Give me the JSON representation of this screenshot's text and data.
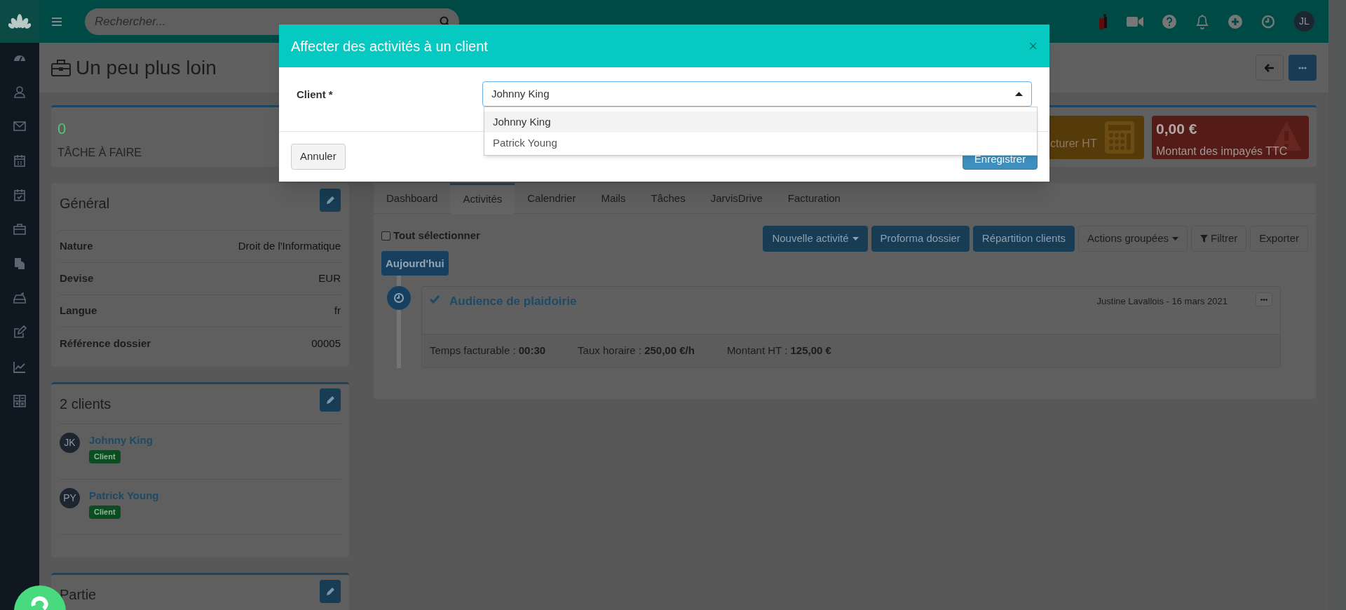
{
  "top_bar": {
    "search": {
      "placeholder": "Rechercher..."
    },
    "avatar": "JL"
  },
  "page": {
    "title": "Un peu plus loin"
  },
  "stats": [
    {
      "kind": "counter",
      "value": "0",
      "label": "TÂCHE À FAIRE"
    },
    {
      "kind": "tile",
      "label": "cturer HT",
      "color": "#553a0a"
    },
    {
      "kind": "tile",
      "value": "0,00 €",
      "label": "Montant des impayés TTC",
      "color": "#541b17"
    }
  ],
  "general": {
    "title": "Général",
    "rows": [
      {
        "label": "Nature",
        "value": "Droit de l'Informatique"
      },
      {
        "label": "Devise",
        "value": "EUR"
      },
      {
        "label": "Langue",
        "value": "fr"
      },
      {
        "label": "Référence dossier",
        "value": "00005"
      }
    ]
  },
  "clients": {
    "title": "2 clients",
    "items": [
      {
        "initials": "JK",
        "name": "Johnny King",
        "tag": "Client"
      },
      {
        "initials": "PY",
        "name": "Patrick Young",
        "tag": "Client"
      }
    ]
  },
  "partie": {
    "title": "Partie"
  },
  "tabs": [
    {
      "label": "Dashboard",
      "selected": false
    },
    {
      "label": "Activités",
      "selected": true
    },
    {
      "label": "Calendrier",
      "selected": false
    },
    {
      "label": "Mails",
      "selected": false
    },
    {
      "label": "Tâches",
      "selected": false
    },
    {
      "label": "JarvisDrive",
      "selected": false
    },
    {
      "label": "Facturation",
      "selected": false
    }
  ],
  "select_all": {
    "label": "Tout sélectionner",
    "checked": false
  },
  "actions": [
    {
      "label": "Nouvelle activité",
      "kind": "primary",
      "caret": true
    },
    {
      "label": "Proforma dossier",
      "kind": "primary",
      "caret": false
    },
    {
      "label": "Répartition clients",
      "kind": "primary",
      "caret": false
    },
    {
      "label": "Actions groupées",
      "kind": "default",
      "caret": true
    },
    {
      "label": "Filtrer",
      "kind": "filter",
      "caret": false
    },
    {
      "label": "Exporter",
      "kind": "default",
      "caret": false
    }
  ],
  "timeline": {
    "date_badge": "Aujourd'hui",
    "activities": [
      {
        "title": "Audience de plaidoirie",
        "checked": true,
        "meta": "Justine Lavallois - 16 mars 2021",
        "details": [
          "Temps facturable : **00:30**",
          "Taux horaire : **250,00 €/h**",
          "Montant HT : **125,00 €**"
        ]
      }
    ]
  },
  "modal": {
    "title": "Affecter des activités à un client",
    "close": "×",
    "field_label": "Client *",
    "value": "Johnny King",
    "options": [
      {
        "label": "Johnny King",
        "selected": true
      },
      {
        "label": "Patrick Young",
        "selected": false
      }
    ],
    "buttons": [
      {
        "label": "Annuler",
        "kind": "default"
      },
      {
        "label": "Enregistrer",
        "kind": "primary"
      }
    ]
  }
}
